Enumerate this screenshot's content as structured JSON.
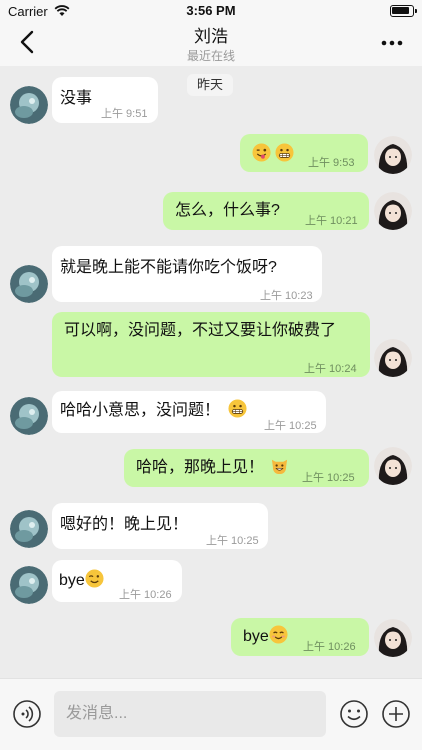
{
  "status_bar": {
    "carrier": "Carrier",
    "time": "3:56 PM"
  },
  "header": {
    "title": "刘浩",
    "subtitle": "最近在线"
  },
  "date_separator": "昨天",
  "messages": [
    {
      "direction": "in",
      "text": "没事",
      "time": "上午 9:51"
    },
    {
      "direction": "out",
      "text": "",
      "emojis": [
        "winking-tongue-emoji",
        "grimacing-emoji"
      ],
      "time": "上午 9:53"
    },
    {
      "direction": "out",
      "text": "怎么，什么事?",
      "time": "上午 10:21"
    },
    {
      "direction": "in",
      "text": "就是晚上能不能请你吃个饭呀?",
      "time": "上午 10:23"
    },
    {
      "direction": "out",
      "text": "可以啊，没问题，不过又要让你破费了",
      "time": "上午 10:24"
    },
    {
      "direction": "in",
      "text": "哈哈小意思，没问题！",
      "emojis": [
        "grimacing-emoji"
      ],
      "time": "上午 10:25"
    },
    {
      "direction": "out",
      "text": "哈哈，那晚上见！",
      "emojis": [
        "grinning-cat-emoji"
      ],
      "time": "上午 10:25"
    },
    {
      "direction": "in",
      "text": "嗯好的！晚上见！",
      "time": "上午 10:25"
    },
    {
      "direction": "in",
      "text": "bye",
      "emojis": [
        "winking-face-emoji"
      ],
      "time": "上午 10:26"
    },
    {
      "direction": "out",
      "text": "bye",
      "emojis": [
        "smiling-face-emoji"
      ],
      "time": "上午 10:26"
    }
  ],
  "input": {
    "placeholder": "发消息..."
  },
  "icons": [
    "back-chevron-icon",
    "more-dots-icon",
    "voice-icon",
    "emoji-icon",
    "plus-icon",
    "wifi-icon",
    "battery-icon"
  ],
  "colors": {
    "outgoing_bubble": "#c9f7a6",
    "incoming_bubble": "#ffffff",
    "chat_background": "#ececec"
  }
}
